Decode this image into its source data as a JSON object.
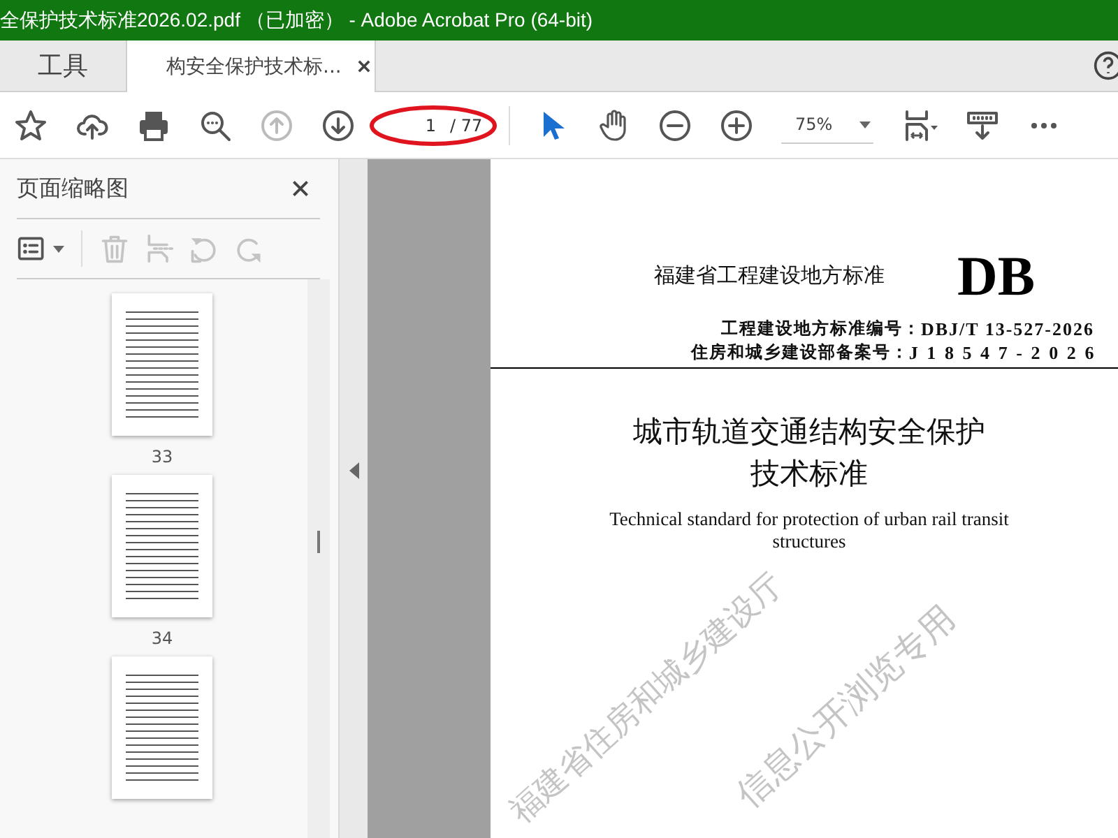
{
  "window": {
    "title": "全保护技术标准2026.02.pdf （已加密） - Adobe Acrobat Pro (64-bit)"
  },
  "tabs": [
    {
      "label": "工具",
      "selected": false
    },
    {
      "label": "构安全保护技术标...",
      "selected": true
    }
  ],
  "toolbar": [
    {
      "kind": "star",
      "disabled": false
    },
    {
      "kind": "cloud",
      "disabled": false
    },
    {
      "kind": "print",
      "disabled": false
    },
    {
      "kind": "search",
      "disabled": false
    },
    {
      "kind": "up",
      "disabled": true
    },
    {
      "kind": "down",
      "disabled": false
    },
    {
      "kind": "page",
      "value": "1",
      "total": "/ 77"
    },
    {
      "kind": "separator"
    },
    {
      "kind": "pointer",
      "selected": true
    },
    {
      "kind": "hand",
      "selected": false
    },
    {
      "kind": "zoomout",
      "disabled": false
    },
    {
      "kind": "zoomin",
      "disabled": false
    },
    {
      "kind": "zoom",
      "value": "75%"
    },
    {
      "kind": "fit",
      "disabled": false
    },
    {
      "kind": "ruler",
      "disabled": false
    },
    {
      "kind": "more",
      "disabled": false
    }
  ],
  "sidebar": {
    "title": "页面缩略图",
    "tools": [
      {
        "kind": "options",
        "disabled": false
      },
      {
        "kind": "separator"
      },
      {
        "kind": "trash",
        "disabled": true
      },
      {
        "kind": "insert",
        "disabled": true
      },
      {
        "kind": "undo",
        "disabled": true
      },
      {
        "kind": "redo",
        "disabled": true
      }
    ],
    "thumbnails": [
      {
        "kind": "page",
        "label": "33"
      },
      {
        "kind": "page",
        "label": "34"
      },
      {
        "kind": "page"
      }
    ]
  },
  "document": {
    "agency": "福建省工程建设地方标准",
    "mark": "DB",
    "codes": [
      {
        "label": "工程建设地方标准编号：",
        "value": "DBJ/T 13-527-2026",
        "spaced": false
      },
      {
        "label": "住房和城乡建设部备案号：",
        "value": "J18547-2026",
        "spaced": true
      }
    ],
    "title_lines": [
      "城市轨道交通结构安全保护",
      "技术标准"
    ],
    "subtitle_lines": [
      "Technical standard for protection of urban rail transit",
      "structures"
    ],
    "watermark_lines": [
      "福建省住房和城乡建设厅",
      "信息公开浏览专用"
    ]
  }
}
